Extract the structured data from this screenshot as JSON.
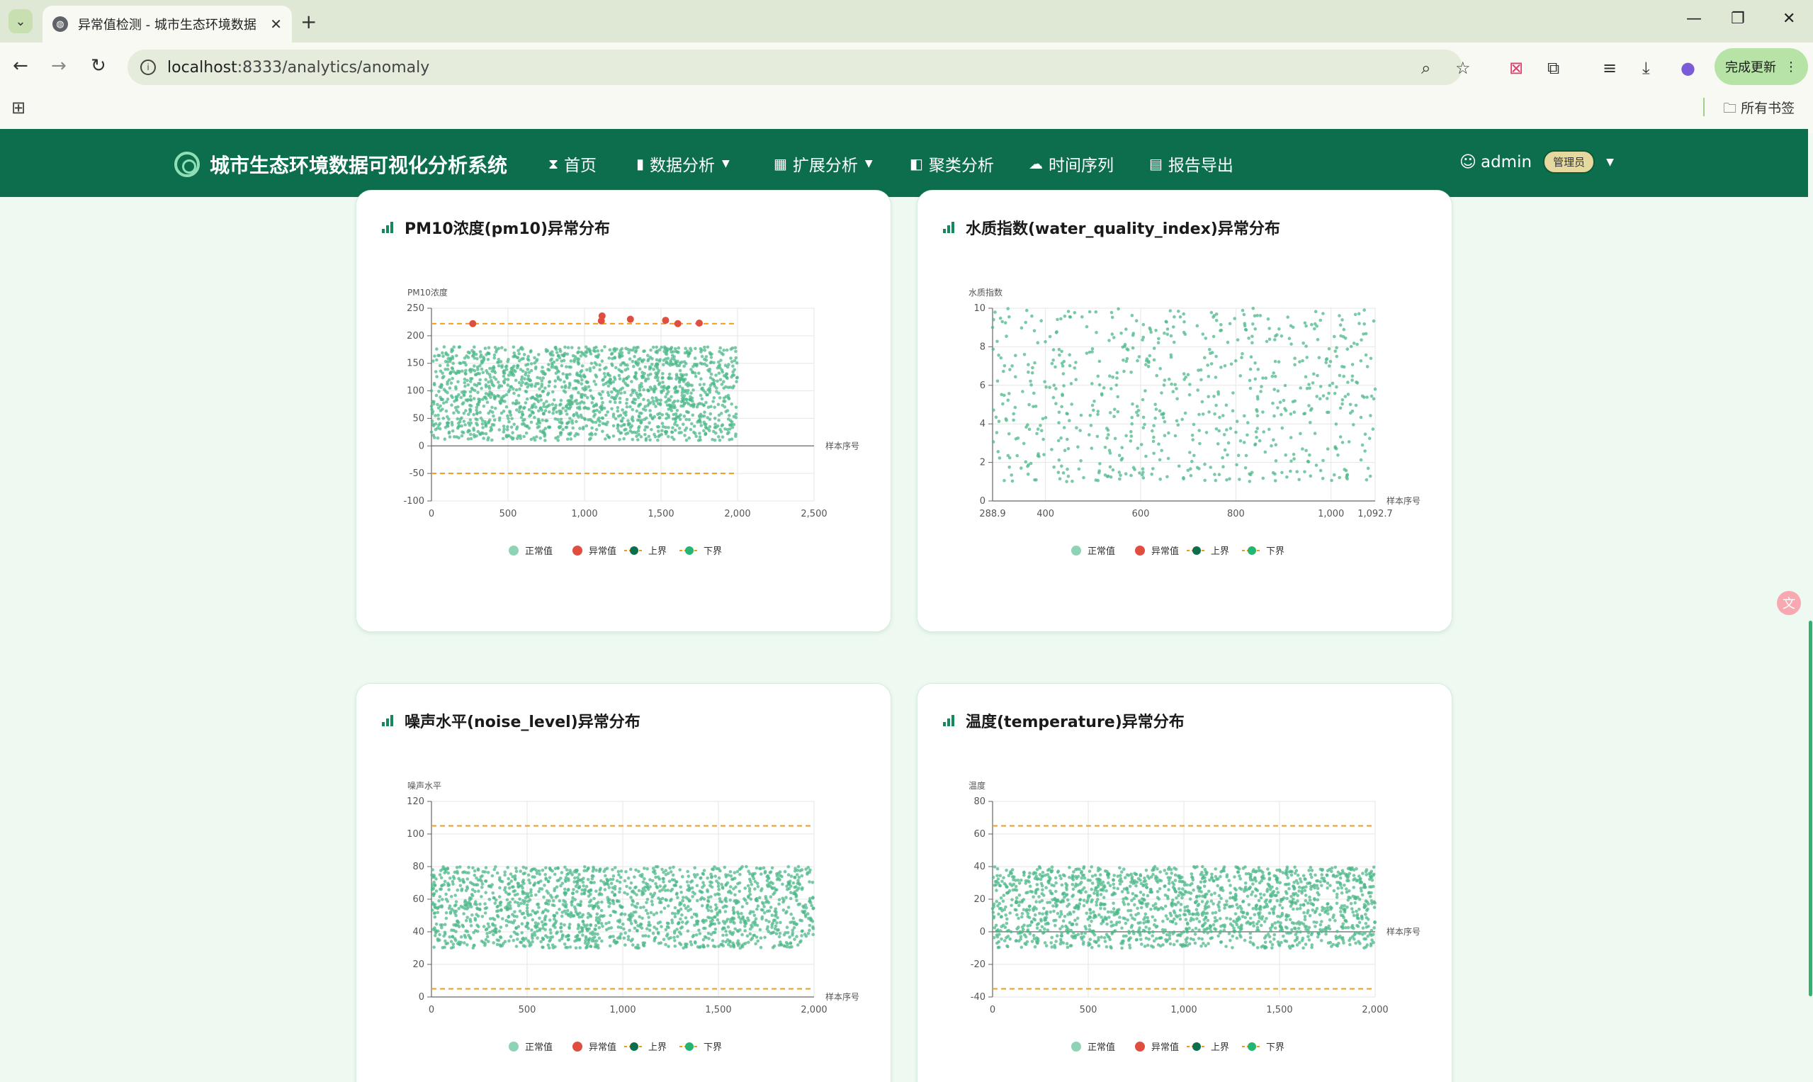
{
  "browser": {
    "tab_title": "异常值检测 - 城市生态环境数据",
    "url_host": "localhost",
    "url_rest": ":8333/analytics/anomaly",
    "update_label": "完成更新",
    "bookmarks_label": "所有书签"
  },
  "nav": {
    "brand": "城市生态环境数据可视化分析系统",
    "items": [
      {
        "label": "首页",
        "icon": "hourglass-icon"
      },
      {
        "label": "数据分析",
        "icon": "bar-chart-icon",
        "dropdown": true
      },
      {
        "label": "扩展分析",
        "icon": "grid-icon",
        "dropdown": true
      },
      {
        "label": "聚类分析",
        "icon": "panel-icon"
      },
      {
        "label": "时间序列",
        "icon": "cloud-icon"
      },
      {
        "label": "报告导出",
        "icon": "file-icon"
      }
    ],
    "user": "admin",
    "role": "管理员"
  },
  "colors": {
    "primary": "#0c6e4c",
    "normal": "#4db88a",
    "anomaly": "#e04e3f",
    "bound": "#f39c12"
  },
  "legend": {
    "normal": "正常值",
    "anomaly": "异常值",
    "upper": "上界",
    "lower": "下界"
  },
  "cards": [
    {
      "title": "PM10浓度(pm10)异常分布"
    },
    {
      "title": "水质指数(water_quality_index)异常分布"
    },
    {
      "title": "噪声水平(noise_level)异常分布"
    },
    {
      "title": "温度(temperature)异常分布"
    }
  ],
  "chart_data": [
    {
      "type": "scatter",
      "ylabel": "PM10浓度",
      "xlabel": "样本序号",
      "xlim": [
        0,
        2500
      ],
      "ylim": [
        -100,
        250
      ],
      "xticks": [
        "0",
        "500",
        "1,000",
        "1,500",
        "2,000",
        "2,500"
      ],
      "yticks": [
        "-100",
        "-50",
        "0",
        "50",
        "100",
        "150",
        "200",
        "250"
      ],
      "normal_range": {
        "x": [
          0,
          2000
        ],
        "y": [
          10,
          180
        ]
      },
      "upper_bound": 222,
      "lower_bound": -50,
      "bound_x_end": 2000,
      "anomalies": [
        [
          270,
          222
        ],
        [
          1110,
          227
        ],
        [
          1115,
          236
        ],
        [
          1300,
          230
        ],
        [
          1530,
          228
        ],
        [
          1610,
          222
        ],
        [
          1750,
          223
        ]
      ],
      "series": [
        {
          "name": "正常值"
        },
        {
          "name": "异常值"
        },
        {
          "name": "上界"
        },
        {
          "name": "下界"
        }
      ]
    },
    {
      "type": "scatter",
      "ylabel": "水质指数",
      "xlabel": "样本序号",
      "xlim": [
        288.9,
        1092.7
      ],
      "ylim": [
        0,
        10
      ],
      "xticks": [
        "288.9",
        "400",
        "600",
        "800",
        "1,000",
        "1,092.7"
      ],
      "yticks": [
        "0",
        "2",
        "4",
        "6",
        "8",
        "10"
      ],
      "normal_range": {
        "x": [
          288.9,
          1092.7
        ],
        "y": [
          1,
          10
        ]
      },
      "upper_bound": null,
      "lower_bound": null,
      "anomalies": [],
      "series": [
        {
          "name": "正常值"
        },
        {
          "name": "异常值"
        },
        {
          "name": "上界"
        },
        {
          "name": "下界"
        }
      ]
    },
    {
      "type": "scatter",
      "ylabel": "噪声水平",
      "xlabel": "样本序号",
      "xlim": [
        0,
        2000
      ],
      "ylim": [
        0,
        120
      ],
      "xticks": [
        "0",
        "500",
        "1,000",
        "1,500",
        "2,000"
      ],
      "yticks": [
        "0",
        "20",
        "40",
        "60",
        "80",
        "100",
        "120"
      ],
      "normal_range": {
        "x": [
          0,
          2000
        ],
        "y": [
          30,
          80
        ]
      },
      "upper_bound": 105,
      "lower_bound": 5,
      "bound_x_end": 2000,
      "anomalies": [],
      "series": [
        {
          "name": "正常值"
        },
        {
          "name": "异常值"
        },
        {
          "name": "上界"
        },
        {
          "name": "下界"
        }
      ]
    },
    {
      "type": "scatter",
      "ylabel": "温度",
      "xlabel": "样本序号",
      "xlim": [
        0,
        2000
      ],
      "ylim": [
        -40,
        80
      ],
      "xticks": [
        "0",
        "500",
        "1,000",
        "1,500",
        "2,000"
      ],
      "yticks": [
        "-40",
        "-20",
        "0",
        "20",
        "40",
        "60",
        "80"
      ],
      "normal_range": {
        "x": [
          0,
          2000
        ],
        "y": [
          -10,
          40
        ]
      },
      "upper_bound": 65,
      "lower_bound": -35,
      "bound_x_end": 2000,
      "anomalies": [],
      "series": [
        {
          "name": "正常值"
        },
        {
          "name": "异常值"
        },
        {
          "name": "上界"
        },
        {
          "name": "下界"
        }
      ]
    }
  ]
}
